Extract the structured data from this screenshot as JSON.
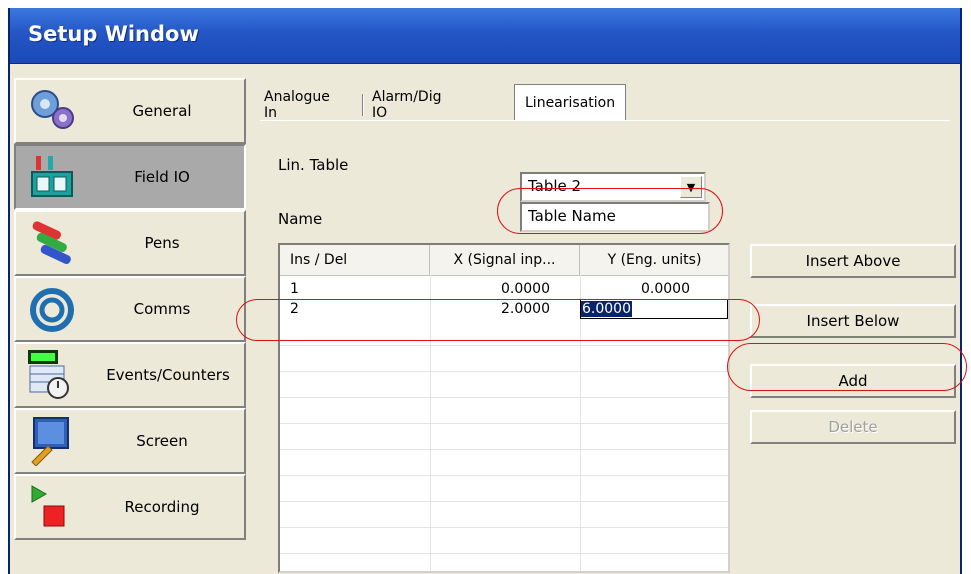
{
  "window": {
    "title": "Setup Window"
  },
  "sidebar": {
    "items": [
      {
        "label": "General",
        "icon": "gears-icon",
        "active": false
      },
      {
        "label": "Field IO",
        "icon": "io-module-icon",
        "active": true
      },
      {
        "label": "Pens",
        "icon": "pens-icon",
        "active": false
      },
      {
        "label": "Comms",
        "icon": "cable-icon",
        "active": false
      },
      {
        "label": "Events/Counters",
        "icon": "counter-calendar-icon",
        "active": false
      },
      {
        "label": "Screen",
        "icon": "screen-wrench-icon",
        "active": false
      },
      {
        "label": "Recording",
        "icon": "play-record-icon",
        "active": false
      }
    ]
  },
  "tabs": [
    {
      "label": "Analogue In",
      "active": false
    },
    {
      "label": "Alarm/Dig IO",
      "active": false
    },
    {
      "label": "Linearisation",
      "active": true
    }
  ],
  "form": {
    "lin_table_label": "Lin. Table",
    "lin_table_value": "Table 2",
    "name_label": "Name",
    "name_value": "Table Name"
  },
  "table": {
    "headers": [
      "Ins / Del",
      "X (Signal inp...",
      "Y (Eng. units)"
    ],
    "rows": [
      {
        "index": "1",
        "x": "0.0000",
        "y": "0.0000"
      },
      {
        "index": "2",
        "x": "2.0000",
        "y": "6.0000"
      }
    ]
  },
  "buttons": {
    "insert_above": "Insert Above",
    "insert_below": "Insert Below",
    "add": "Add",
    "delete": "Delete"
  },
  "colors": {
    "title_bar": "#2456c6",
    "selection": "#0a246a",
    "callout": "#dd1111",
    "active_sidebar": "#a9a9a9"
  }
}
